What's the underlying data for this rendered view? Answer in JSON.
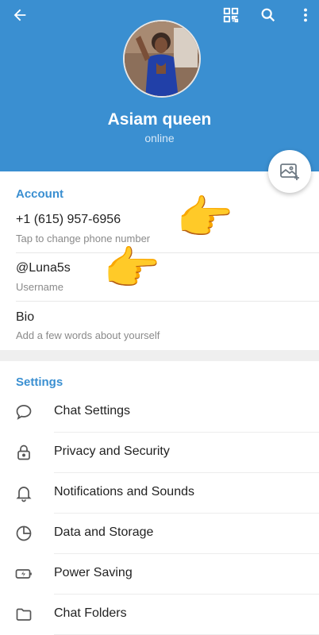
{
  "header": {
    "name": "Asiam queen",
    "status": "online",
    "icons": [
      "arrow-back-icon",
      "qr-code-icon",
      "search-icon",
      "more-vertical-icon"
    ],
    "accent": "#3a8fd1"
  },
  "account": {
    "title": "Account",
    "phone": "+1 (615) 957-6956",
    "phone_hint": "Tap to change phone number",
    "username": "@Luna5s",
    "username_hint": "Username",
    "bio": "Bio",
    "bio_hint": "Add a few words about yourself"
  },
  "settings": {
    "title": "Settings",
    "items": [
      {
        "label": "Chat Settings",
        "icon": "chat-bubble-icon"
      },
      {
        "label": "Privacy and Security",
        "icon": "lock-icon"
      },
      {
        "label": "Notifications and Sounds",
        "icon": "bell-icon"
      },
      {
        "label": "Data and Storage",
        "icon": "pie-chart-icon"
      },
      {
        "label": "Power Saving",
        "icon": "battery-icon"
      },
      {
        "label": "Chat Folders",
        "icon": "folder-icon"
      }
    ]
  },
  "annotations": [
    "pointing-hand-icon",
    "pointing-hand-icon"
  ]
}
